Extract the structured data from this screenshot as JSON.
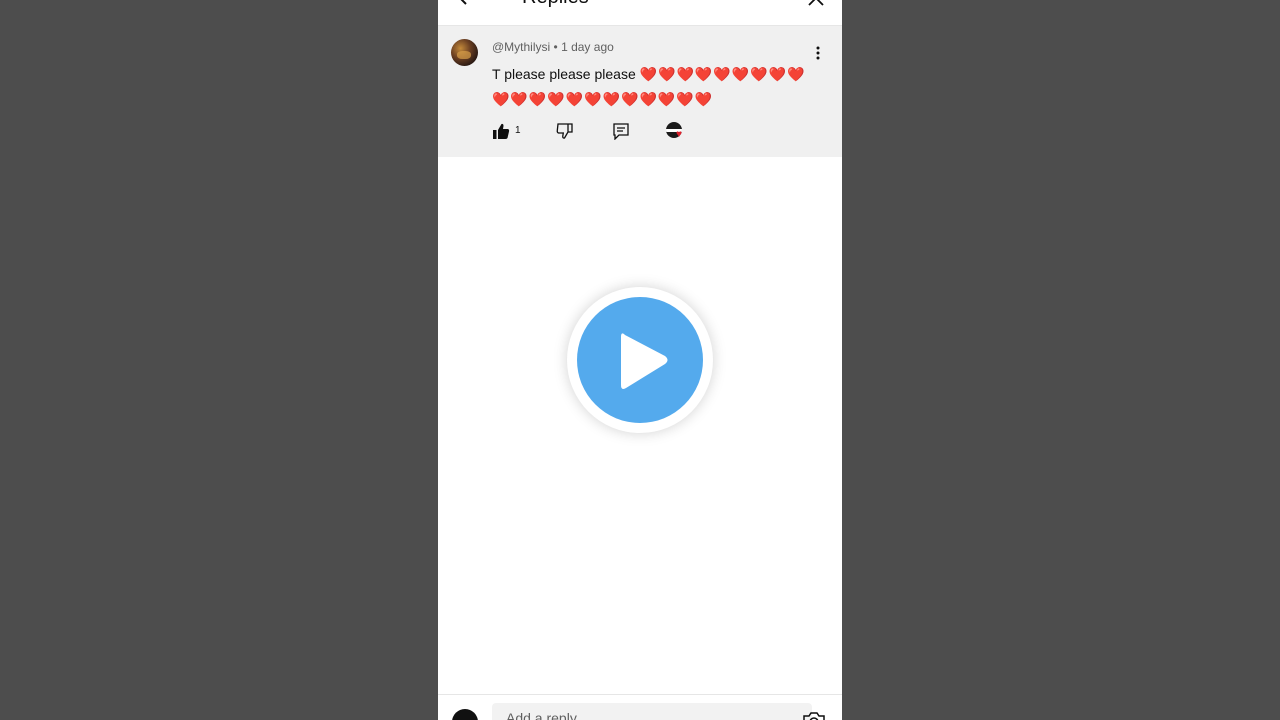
{
  "header": {
    "title": "Replies",
    "back_icon": "back-arrow-icon",
    "close_icon": "close-icon"
  },
  "comment": {
    "handle": "@Mythilysi",
    "separator": "•",
    "time": "1 day ago",
    "text": "T please please please",
    "hearts_line1": "❤️❤️❤️❤️❤️❤️❤️❤️❤️",
    "hearts_line2": "❤️❤️❤️❤️❤️❤️❤️❤️❤️❤️❤️❤️",
    "like_count": "1",
    "icons": [
      "thumbs-up-icon",
      "thumbs-down-icon",
      "reply-icon",
      "creator-heart-icon",
      "more-vert-icon"
    ]
  },
  "player": {
    "icon": "play-icon",
    "accent": "#54aaed"
  },
  "footer": {
    "reply_placeholder": "Add a reply...",
    "camera_icon": "camera-icon"
  },
  "colors": {
    "backdrop": "#4d4d4d",
    "comment_bg": "#f0f0f0",
    "heart": "#e0202b"
  }
}
